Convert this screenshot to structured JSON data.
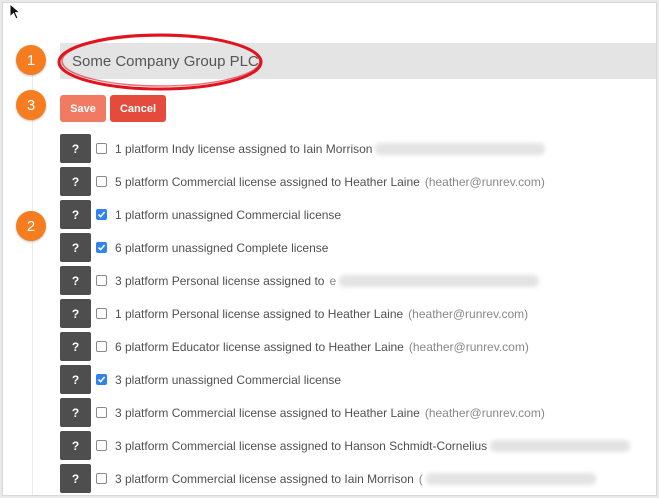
{
  "company": {
    "name": "Some Company Group PLC"
  },
  "steps": [
    "1",
    "2",
    "3"
  ],
  "actions": {
    "save_label": "Save",
    "cancel_label": "Cancel"
  },
  "licenses": {
    "help_label": "?",
    "items": [
      {
        "text": "1 platform Indy license assigned to Iain Morrison",
        "email": "",
        "checked": false,
        "redacted": true
      },
      {
        "text": "5 platform Commercial license assigned to Heather Laine",
        "email": "(heather@runrev.com)",
        "checked": false,
        "redacted": false
      },
      {
        "text": "1 platform unassigned Commercial license",
        "email": "",
        "checked": true,
        "redacted": false
      },
      {
        "text": "6 platform unassigned Complete license",
        "email": "",
        "checked": true,
        "redacted": false
      },
      {
        "text": "3 platform Personal license assigned to",
        "email": "e",
        "checked": false,
        "redacted": true
      },
      {
        "text": "1 platform Personal license assigned to Heather Laine",
        "email": "(heather@runrev.com)",
        "checked": false,
        "redacted": false
      },
      {
        "text": "6 platform Educator license assigned to Heather Laine",
        "email": "(heather@runrev.com)",
        "checked": false,
        "redacted": false
      },
      {
        "text": "3 platform unassigned Commercial license",
        "email": "",
        "checked": true,
        "redacted": false
      },
      {
        "text": "3 platform Commercial license assigned to Heather Laine",
        "email": "(heather@runrev.com)",
        "checked": false,
        "redacted": false
      },
      {
        "text": "3 platform Commercial license assigned to Hanson Schmidt-Cornelius",
        "email": "",
        "checked": false,
        "redacted": true
      },
      {
        "text": "3 platform Commercial license assigned to Iain Morrison",
        "email": "(",
        "checked": false,
        "redacted": true
      }
    ]
  },
  "colors": {
    "step_badge": "#f57c1f",
    "save_button": "#f07a62",
    "cancel_button": "#e54b3c",
    "help_button": "#4e4e4e",
    "checkbox_checked": "#2f83f0",
    "annotation_ellipse": "#e0141e"
  }
}
